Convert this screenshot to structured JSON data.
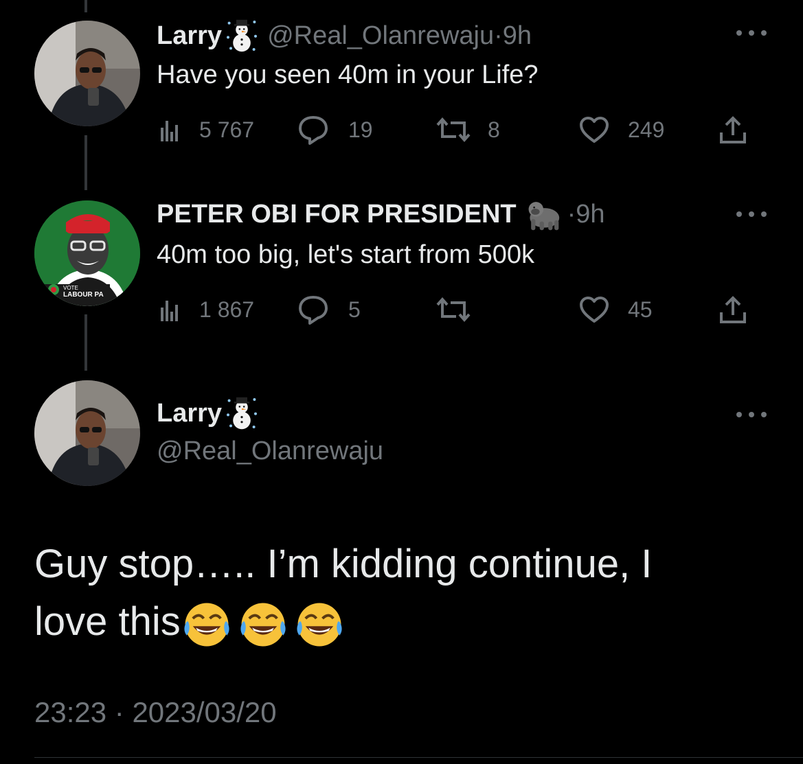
{
  "tweets": [
    {
      "name": "Larry",
      "name_emoji": "snowman-emoji",
      "handle": "@Real_Olanrewaju",
      "sep": " · ",
      "time": "9h",
      "text": "Have you seen 40m in your Life?",
      "views": "5 767",
      "replies": "19",
      "retweets": "8",
      "likes": "249"
    },
    {
      "name": "PETER OBI FOR PRESIDENT",
      "name_emoji": "gorilla-emoji",
      "sep": " · ",
      "time": "9h",
      "text": "40m too big, let's start from 500k",
      "views": "1 867",
      "replies": "5",
      "retweets": "",
      "likes": "45",
      "avatar_text": "LABOUR PA",
      "avatar_vote": "VOTE"
    }
  ],
  "main_tweet": {
    "name": "Larry",
    "name_emoji": "snowman-emoji",
    "handle": "@Real_Olanrewaju",
    "text_line1": "Guy stop….. I’m kidding continue, I",
    "text_line2": "love this",
    "text_emojis": [
      "tears-of-joy-emoji",
      "tears-of-joy-emoji",
      "tears-of-joy-emoji"
    ],
    "time": "23:23",
    "sep": " · ",
    "date": "2023/03/20"
  },
  "colors": {
    "background": "#000000",
    "text": "#e7e9ea",
    "muted": "#71767b",
    "thread_line": "#333639"
  }
}
